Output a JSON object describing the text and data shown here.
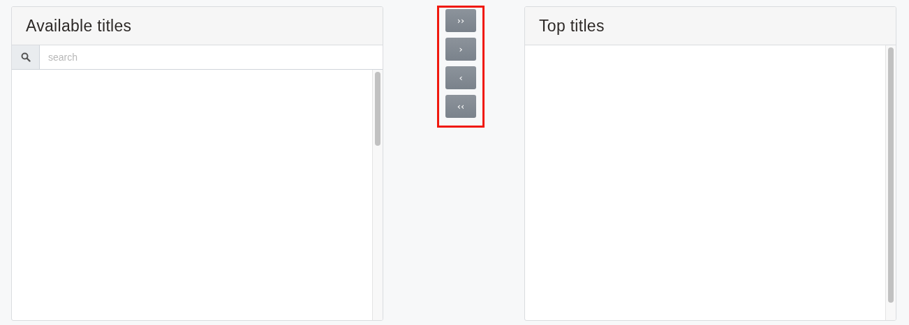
{
  "available_panel": {
    "title": "Available titles",
    "search": {
      "placeholder": "search"
    }
  },
  "transfer_buttons": [
    {
      "label": "››"
    },
    {
      "label": "›"
    },
    {
      "label": "‹"
    },
    {
      "label": "‹‹"
    }
  ],
  "top_panel": {
    "title": "Top titles"
  }
}
